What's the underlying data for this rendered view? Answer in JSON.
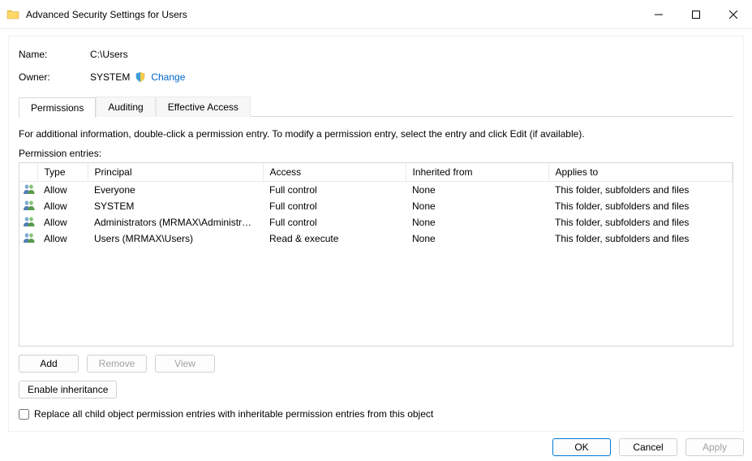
{
  "window": {
    "title": "Advanced Security Settings for Users"
  },
  "meta": {
    "name_label": "Name:",
    "name_value": "C:\\Users",
    "owner_label": "Owner:",
    "owner_value": "SYSTEM",
    "change_link": "Change"
  },
  "tabs": [
    {
      "label": "Permissions",
      "active": true
    },
    {
      "label": "Auditing",
      "active": false
    },
    {
      "label": "Effective Access",
      "active": false
    }
  ],
  "instruction": "For additional information, double-click a permission entry. To modify a permission entry, select the entry and click Edit (if available).",
  "entries_label": "Permission entries:",
  "grid": {
    "headers": {
      "type": "Type",
      "principal": "Principal",
      "access": "Access",
      "inherited": "Inherited from",
      "applies": "Applies to"
    },
    "rows": [
      {
        "type": "Allow",
        "principal": "Everyone",
        "access": "Full control",
        "inherited": "None",
        "applies": "This folder, subfolders and files"
      },
      {
        "type": "Allow",
        "principal": "SYSTEM",
        "access": "Full control",
        "inherited": "None",
        "applies": "This folder, subfolders and files"
      },
      {
        "type": "Allow",
        "principal": "Administrators (MRMAX\\Administrat...",
        "access": "Full control",
        "inherited": "None",
        "applies": "This folder, subfolders and files"
      },
      {
        "type": "Allow",
        "principal": "Users (MRMAX\\Users)",
        "access": "Read & execute",
        "inherited": "None",
        "applies": "This folder, subfolders and files"
      }
    ]
  },
  "buttons": {
    "add": "Add",
    "remove": "Remove",
    "view": "View",
    "enable_inheritance": "Enable inheritance",
    "replace_label": "Replace all child object permission entries with inheritable permission entries from this object",
    "ok": "OK",
    "cancel": "Cancel",
    "apply": "Apply"
  }
}
